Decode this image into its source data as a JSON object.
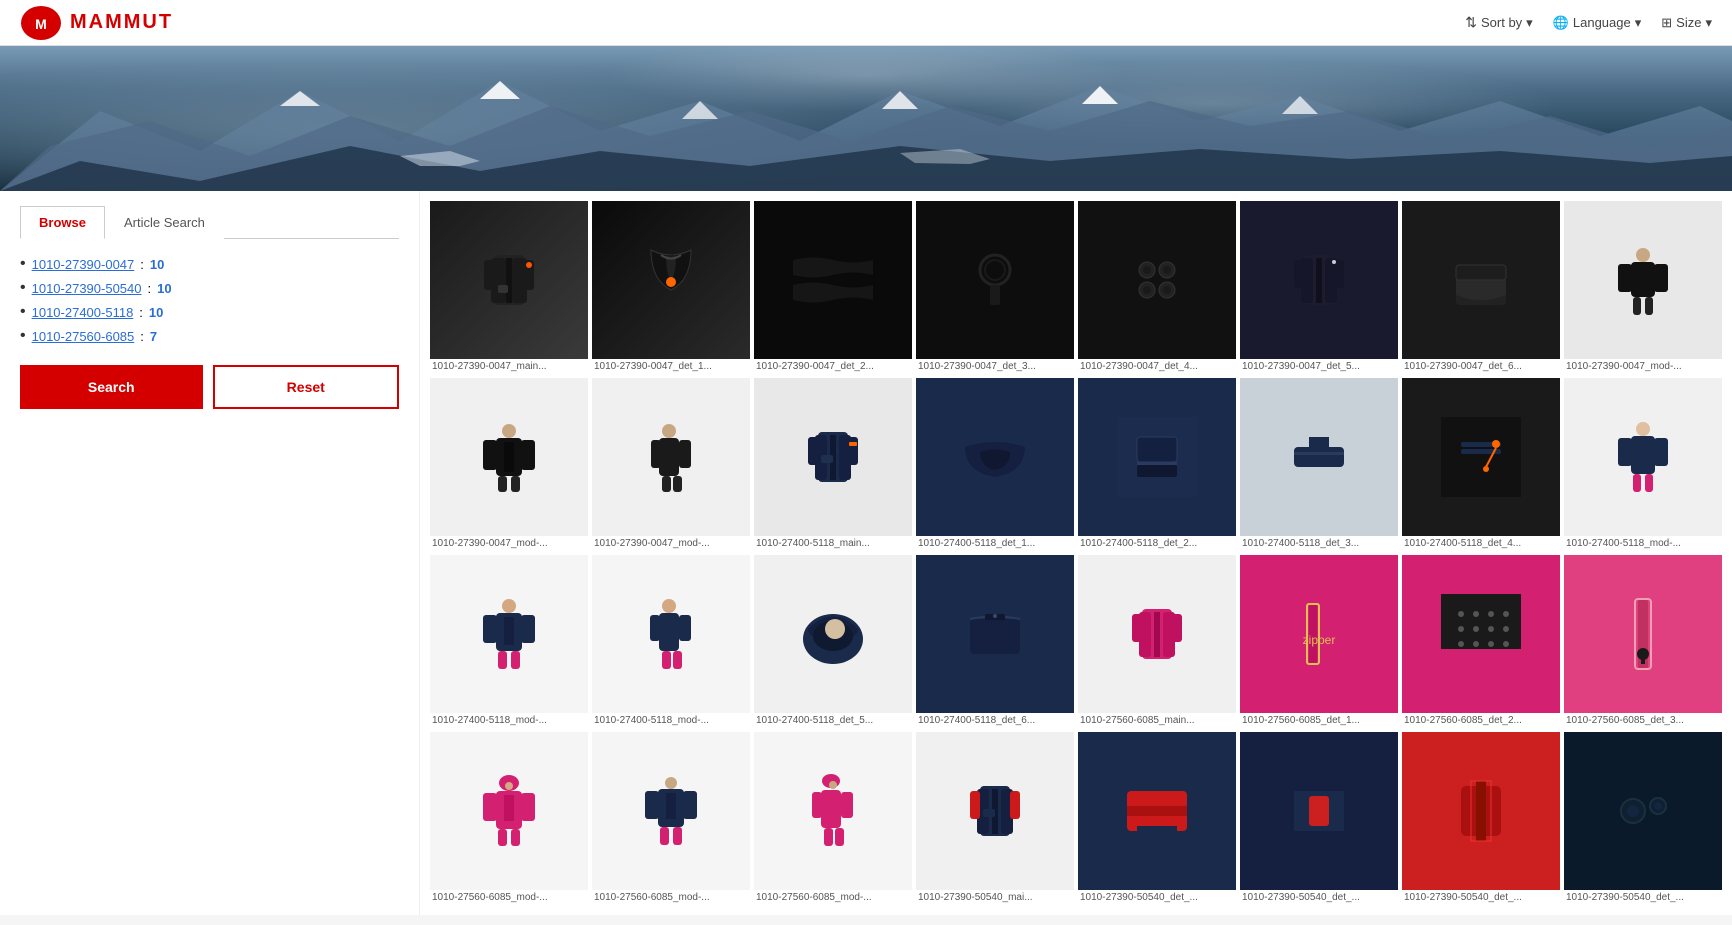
{
  "header": {
    "logo_text": "MAMMUT",
    "sort_by": "Sort by",
    "language": "Language",
    "size": "Size"
  },
  "tabs": [
    {
      "id": "browse",
      "label": "Browse",
      "active": true
    },
    {
      "id": "article-search",
      "label": "Article Search",
      "active": false
    }
  ],
  "articles": [
    {
      "number": "1010-27390-0047",
      "count": "10"
    },
    {
      "number": "1010-27390-50540",
      "count": "10"
    },
    {
      "number": "1010-27400-5118",
      "count": "10"
    },
    {
      "number": "1010-27560-6085",
      "count": "7"
    }
  ],
  "buttons": {
    "search": "Search",
    "reset": "Reset"
  },
  "gallery": {
    "rows": [
      {
        "items": [
          {
            "label": "1010-27390-0047_main...",
            "color": "black",
            "type": "jacket-front"
          },
          {
            "label": "1010-27390-0047_det_1...",
            "color": "black-detail",
            "type": "zipper"
          },
          {
            "label": "1010-27390-0047_det_2...",
            "color": "black-detail",
            "type": "fabric"
          },
          {
            "label": "1010-27390-0047_det_3...",
            "color": "black-detail",
            "type": "fabric2"
          },
          {
            "label": "1010-27390-0047_det_4...",
            "color": "black-detail",
            "type": "buttons"
          },
          {
            "label": "1010-27390-0047_det_5...",
            "color": "black",
            "type": "side"
          },
          {
            "label": "1010-27390-0047_det_6...",
            "color": "black",
            "type": "cuff"
          },
          {
            "label": "1010-27390-0047_mod-...",
            "color": "black",
            "type": "back"
          }
        ]
      },
      {
        "items": [
          {
            "label": "1010-27390-0047_mod-...",
            "color": "black",
            "type": "model-front"
          },
          {
            "label": "1010-27390-0047_mod-...",
            "color": "black",
            "type": "model-side"
          },
          {
            "label": "1010-27400-5118_main...",
            "color": "navy",
            "type": "jacket-front"
          },
          {
            "label": "1010-27400-5118_det_1...",
            "color": "navy",
            "type": "detail1"
          },
          {
            "label": "1010-27400-5118_det_2...",
            "color": "navy",
            "type": "detail2"
          },
          {
            "label": "1010-27400-5118_det_3...",
            "color": "navy",
            "type": "detail3"
          },
          {
            "label": "1010-27400-5118_det_4...",
            "color": "navy",
            "type": "detail4"
          },
          {
            "label": "1010-27400-5118_mod-...",
            "color": "navy-pink",
            "type": "model-back"
          }
        ]
      },
      {
        "items": [
          {
            "label": "1010-27400-5118_mod-...",
            "color": "navy-pink",
            "type": "model-front2"
          },
          {
            "label": "1010-27400-5118_mod-...",
            "color": "navy-pink",
            "type": "model-side2"
          },
          {
            "label": "1010-27400-5118_det_5...",
            "color": "navy",
            "type": "hood"
          },
          {
            "label": "1010-27400-5118_det_6...",
            "color": "navy",
            "type": "pocket"
          },
          {
            "label": "1010-27560-6085_main...",
            "color": "pink",
            "type": "jacket-front"
          },
          {
            "label": "1010-27560-6085_det_1...",
            "color": "pink",
            "type": "detail1"
          },
          {
            "label": "1010-27560-6085_det_2...",
            "color": "pink",
            "type": "detail2"
          },
          {
            "label": "1010-27560-6085_det_3...",
            "color": "pink",
            "type": "detail3"
          }
        ]
      },
      {
        "items": [
          {
            "label": "1010-27560-6085_mod-...",
            "color": "pink",
            "type": "model-front3"
          },
          {
            "label": "1010-27560-6085_mod-...",
            "color": "navy-pink",
            "type": "model-front4"
          },
          {
            "label": "1010-27560-6085_mod-...",
            "color": "pink",
            "type": "model-side3"
          },
          {
            "label": "1010-27390-50540_mai...",
            "color": "red-navy",
            "type": "jacket-front"
          },
          {
            "label": "1010-27390-50540_det_...",
            "color": "red-navy",
            "type": "detail1"
          },
          {
            "label": "1010-27390-50540_det_...",
            "color": "red-navy",
            "type": "detail2"
          },
          {
            "label": "1010-27390-50540_det_...",
            "color": "red",
            "type": "detail3"
          },
          {
            "label": "1010-27390-50540_det_...",
            "color": "dark-blue",
            "type": "detail4"
          }
        ]
      }
    ]
  }
}
